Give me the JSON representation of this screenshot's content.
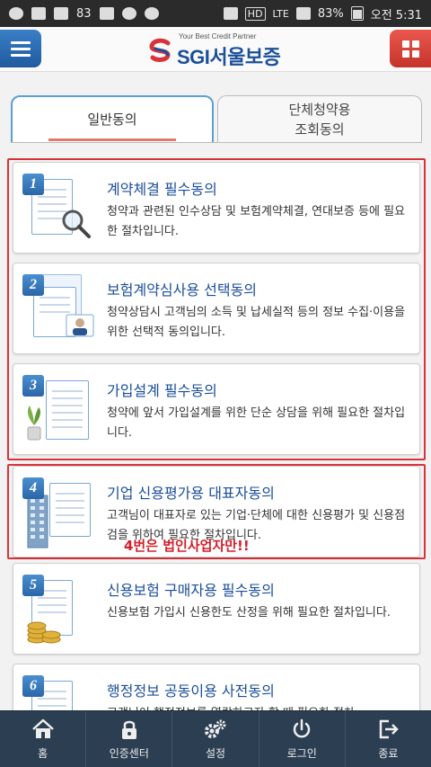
{
  "statusbar": {
    "notif_count": "83",
    "network": "HD",
    "lte": "LTE",
    "battery": "83%",
    "time": "오전 5:31"
  },
  "header": {
    "tagline": "Your Best Credit Partner",
    "logo_text": "SGI서울보증"
  },
  "tabs": [
    {
      "label": "일반동의"
    },
    {
      "label_line1": "단체청약용",
      "label_line2": "조회동의"
    }
  ],
  "items": [
    {
      "num": "1",
      "title": "계약체결 필수동의",
      "desc": "청약과 관련된 인수상담 및 보험계약체결, 연대보증 등에 필요한 절차입니다."
    },
    {
      "num": "2",
      "title": "보험계약심사용 선택동의",
      "desc": "청약상담시 고객님의 소득 및 납세실적 등의 정보 수집·이용을 위한 선택적 동의입니다."
    },
    {
      "num": "3",
      "title": "가입설계 필수동의",
      "desc": "청약에 앞서 가입설계를 위한 단순 상담을 위해 필요한 절차입니다."
    },
    {
      "num": "4",
      "title": "기업 신용평가용 대표자동의",
      "desc": "고객님이 대표자로 있는 기업·단체에 대한 신용평가 및 신용점검을 위하여 필요한 절차입니다."
    },
    {
      "num": "5",
      "title": "신용보험 구매자용 필수동의",
      "desc": "신용보험 가입시 신용한도 산정을 위해 필요한 절차입니다."
    },
    {
      "num": "6",
      "title": "행정정보 공동이용 사전동의",
      "desc": "고객님이 행정정보를 열람하고자 할 때 필요한 절차"
    }
  ],
  "note": "4번은 법인사업자만!!",
  "bottomnav": [
    {
      "label": "홈",
      "icon": "home-icon"
    },
    {
      "label": "인증센터",
      "icon": "lock-icon"
    },
    {
      "label": "설정",
      "icon": "gears-icon"
    },
    {
      "label": "로그인",
      "icon": "power-icon"
    },
    {
      "label": "종료",
      "icon": "exit-icon"
    }
  ],
  "colors": {
    "brand_blue": "#1b4f9a",
    "brand_red": "#d9333a",
    "nav_bg": "#2c3e52"
  }
}
